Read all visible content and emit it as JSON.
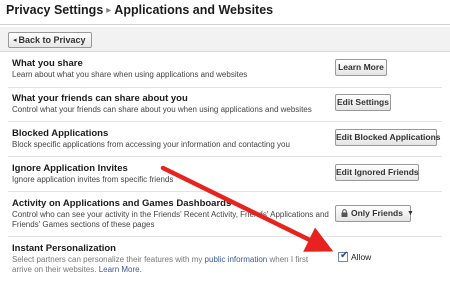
{
  "header": {
    "crumb_root": "Privacy Settings",
    "separator": "▸",
    "crumb_current": "Applications and Websites"
  },
  "back_button": {
    "label": "Back to Privacy",
    "arrow": "◂"
  },
  "rows": [
    {
      "title": "What you share",
      "description": "Learn about what you share when using applications and websites",
      "button": "Learn More"
    },
    {
      "title": "What your friends can share about you",
      "description": "Control what your friends can share about you when using applications and websites",
      "button": "Edit Settings"
    },
    {
      "title": "Blocked Applications",
      "description": "Block specific applications from accessing your information and contacting you",
      "button": "Edit Blocked Applications"
    },
    {
      "title": "Ignore Application Invites",
      "description": "Ignore application invites from specific friends",
      "button": "Edit Ignored Friends"
    },
    {
      "title": "Activity on Applications and Games Dashboards",
      "description_line1": "Control who can see your activity in the Friends' Recent Activity, Friends' Applications and",
      "description_line2": "Friends' Games sections of these pages",
      "dropdown": "Only Friends",
      "dropdown_caret": "▼"
    },
    {
      "title": "Instant Personalization",
      "desc_line1_prefix": "Select partners can personalize their features with my ",
      "desc_line1_link": "public information",
      "desc_line1_suffix": " when I first",
      "desc_line2_prefix": "arrive on their websites. ",
      "desc_line2_link": "Learn More.",
      "checkbox_label": "Allow",
      "checkbox_checked": true
    }
  ],
  "colors": {
    "link": "#3b5998",
    "annotation_arrow": "#e8231f"
  },
  "icons": {
    "lock": "lock-icon",
    "checkmark": "✔"
  }
}
